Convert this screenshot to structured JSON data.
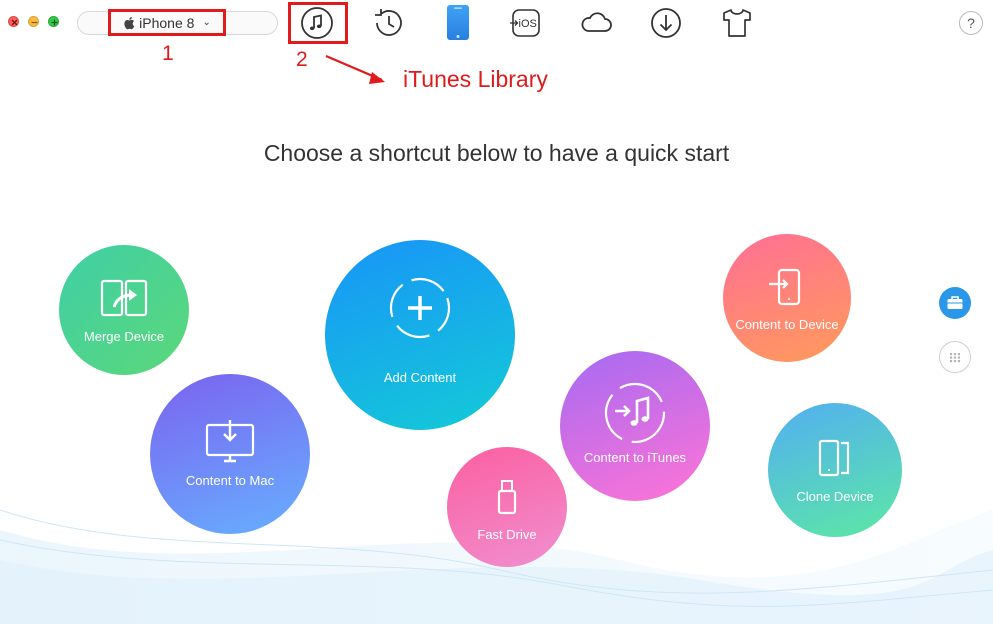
{
  "toolbar": {
    "device": "iPhone 8",
    "help": "?",
    "icons": [
      "itunes-library-icon",
      "backup-history-icon",
      "device-icon",
      "to-ios-icon",
      "icloud-icon",
      "download-icon",
      "theme-shirt-icon"
    ],
    "to_ios_label": "iOS"
  },
  "annotations": {
    "step1": "1",
    "step2": "2",
    "itunes_library": "iTunes Library",
    "color": "#e01b1b"
  },
  "main": {
    "headline": "Choose a shortcut below to have a quick start"
  },
  "shortcuts": {
    "merge_device": "Merge Device",
    "content_to_mac": "Content to Mac",
    "add_content": "Add Content",
    "fast_drive": "Fast Drive",
    "content_to_itunes": "Content to iTunes",
    "content_to_device": "Content to Device",
    "clone_device": "Clone Device"
  },
  "colors": {
    "accent": "#2a97e8",
    "merge": [
      "#3fd3a0",
      "#5bd67a"
    ],
    "mac": [
      "#7a6cf0",
      "#5fb6ff"
    ],
    "add": [
      "#1c9cf6",
      "#19c7d8"
    ],
    "fast": [
      "#f86aa8",
      "#f08ccc"
    ],
    "itunes": [
      "#b96bf0",
      "#ff7ad1"
    ],
    "device": [
      "#ff7a8e",
      "#ff9a5e"
    ],
    "clone": [
      "#5ab5f0",
      "#5ee6a6"
    ]
  }
}
